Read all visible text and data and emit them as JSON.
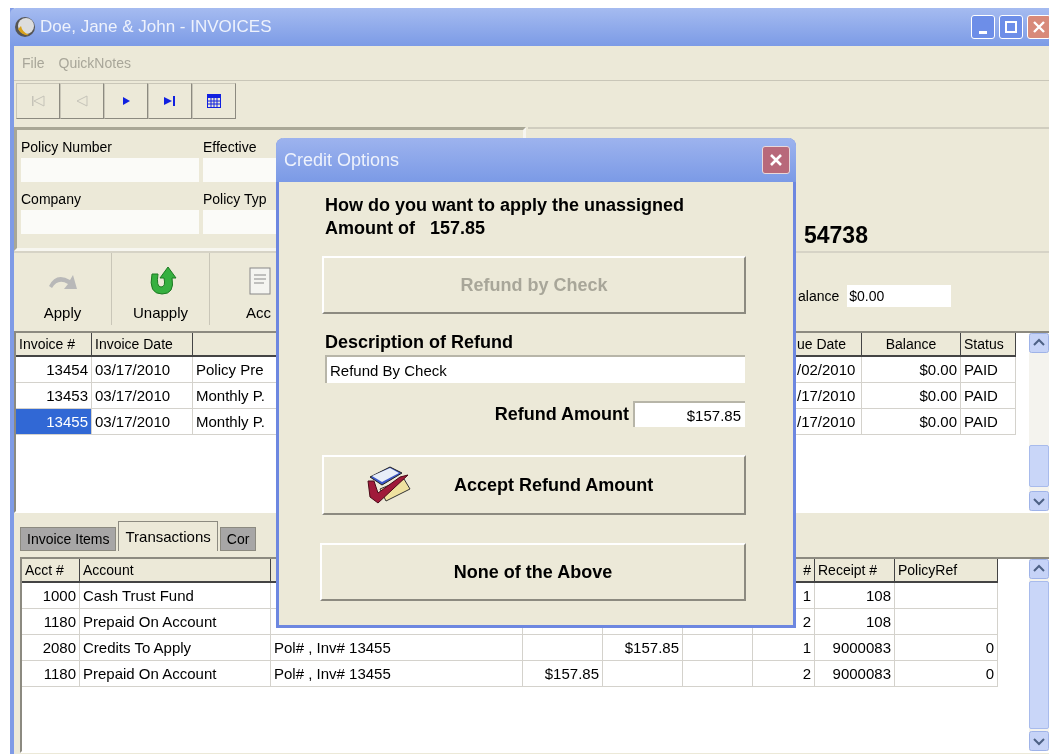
{
  "window": {
    "title": "Doe, Jane & John - INVOICES"
  },
  "menu": [
    {
      "label": "File",
      "disabled": true
    },
    {
      "label": "QuickNotes",
      "disabled": true
    }
  ],
  "nav_buttons": [
    {
      "kind": "first",
      "disabled": true
    },
    {
      "kind": "prev",
      "disabled": true
    },
    {
      "kind": "next",
      "disabled": false
    },
    {
      "kind": "last",
      "disabled": false
    },
    {
      "kind": "calendar",
      "disabled": false
    }
  ],
  "policy_fields": [
    {
      "label": "Policy Number"
    },
    {
      "label": "Effective"
    },
    {
      "label": "Company"
    },
    {
      "label": "Policy Typ"
    }
  ],
  "policy_id": "54738",
  "actions": [
    {
      "kind": "apply",
      "label": "Apply",
      "disabled": true
    },
    {
      "kind": "unapply",
      "label": "Unapply",
      "disabled": false
    },
    {
      "kind": "document",
      "label": "Acc",
      "disabled": false
    }
  ],
  "balance": {
    "label": "alance",
    "value": "$0.00"
  },
  "invoices": {
    "columns": {
      "number": "Invoice #",
      "date": "Invoice Date",
      "due_date": "ue Date",
      "balance": "Balance",
      "status": "Status"
    },
    "rows": [
      {
        "number": "13454",
        "date": "03/17/2010",
        "column_3": "Policy Pre",
        "due_date": "/02/2010",
        "balance": "$0.00",
        "status": "PAID",
        "selected": false
      },
      {
        "number": "13453",
        "date": "03/17/2010",
        "column_3": "Monthly P.",
        "due_date": "/17/2010",
        "balance": "$0.00",
        "status": "PAID",
        "selected": false
      },
      {
        "number": "13455",
        "date": "03/17/2010",
        "column_3": "Monthly P.",
        "due_date": "/17/2010",
        "balance": "$0.00",
        "status": "PAID",
        "selected": true
      }
    ]
  },
  "tabs": [
    {
      "label": "Invoice Items",
      "selected": false
    },
    {
      "label": "Transactions",
      "selected": true
    },
    {
      "label": "Cor",
      "selected": false
    }
  ],
  "transactions": {
    "columns": {
      "acct": "Acct #",
      "account": "Account",
      "column_7": "#",
      "receipt": "Receipt #",
      "policy_ref": "PolicyRef"
    },
    "rows": [
      {
        "acct": "1000",
        "account": "Cash Trust Fund",
        "column_7": "1",
        "receipt": "108"
      },
      {
        "acct": "1180",
        "account": "Prepaid On Account",
        "column_7": "2",
        "receipt": "108"
      },
      {
        "acct": "2080",
        "account": "Credits To Apply",
        "column_3": "Pol# , Inv# 13455",
        "column_5": "$157.85",
        "column_7": "1",
        "receipt": "9000083",
        "policy_ref": "0"
      },
      {
        "acct": "1180",
        "account": "Prepaid On Account",
        "column_3": "Pol# , Inv# 13455",
        "column_4": "$157.85",
        "column_7": "2",
        "receipt": "9000083",
        "policy_ref": "0"
      }
    ]
  },
  "dialog": {
    "title": "Credit Options",
    "prompt": "How do you want to apply the unassigned\nAmount of   157.85",
    "refund_check_button": {
      "label": "Refund by Check",
      "disabled": true
    },
    "description_label": "Description of Refund",
    "description_value": "Refund By Check",
    "amount_label": "Refund Amount",
    "amount_value": "$157.85",
    "accept_button": {
      "label": "Accept Refund Amount"
    },
    "none_button": {
      "label": "None of the Above"
    }
  }
}
